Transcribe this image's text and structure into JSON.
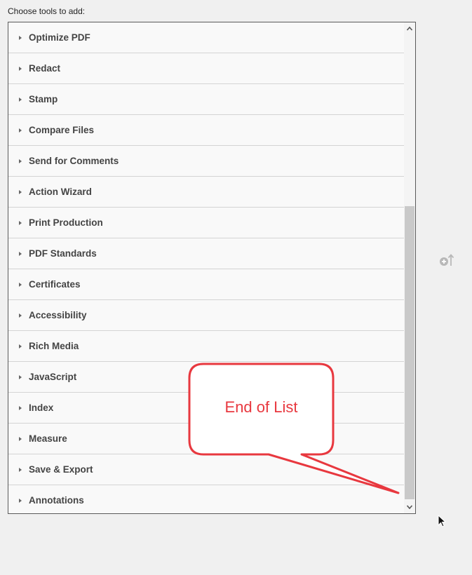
{
  "heading": "Choose tools to add:",
  "tools": [
    "Optimize PDF",
    "Redact",
    "Stamp",
    "Compare Files",
    "Send for Comments",
    "Action Wizard",
    "Print Production",
    "PDF Standards",
    "Certificates",
    "Accessibility",
    "Rich Media",
    "JavaScript",
    "Index",
    "Measure",
    "Save & Export",
    "Annotations"
  ],
  "callout": {
    "text": "End of List",
    "color": "#e8383f"
  },
  "icons": {
    "expand": "caret-right-icon",
    "add": "add-to-toolbar-icon",
    "cursor": "mouse-pointer-icon"
  }
}
